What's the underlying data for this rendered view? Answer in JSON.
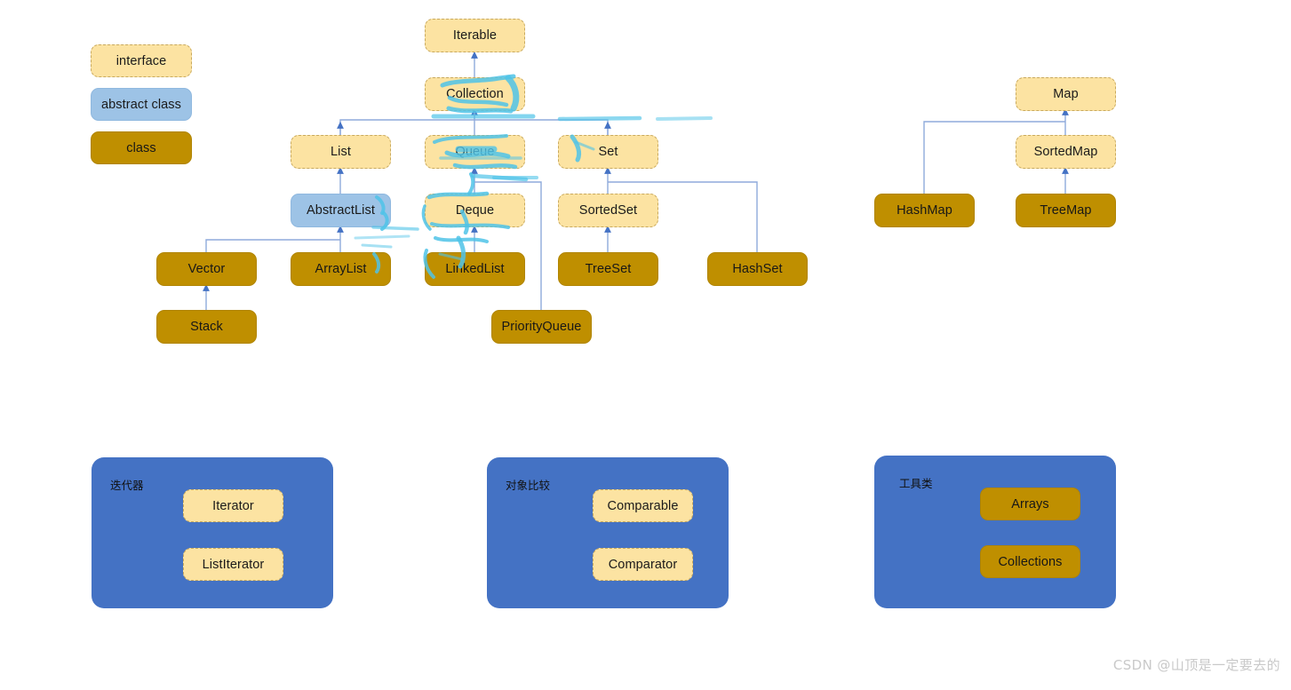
{
  "legend": {
    "items": [
      {
        "label": "interface",
        "kind": "interface",
        "color": "#FCE3A2"
      },
      {
        "label": "abstract class",
        "kind": "abstract",
        "color": "#9DC3E6"
      },
      {
        "label": "class",
        "kind": "class",
        "color": "#BF8F00"
      }
    ]
  },
  "collection_tree": {
    "nodes": [
      {
        "label": "Iterable",
        "kind": "interface"
      },
      {
        "label": "Collection",
        "kind": "interface"
      },
      {
        "label": "List",
        "kind": "interface"
      },
      {
        "label": "Queue",
        "kind": "interface"
      },
      {
        "label": "Set",
        "kind": "interface"
      },
      {
        "label": "AbstractList",
        "kind": "abstract"
      },
      {
        "label": "Deque",
        "kind": "interface"
      },
      {
        "label": "SortedSet",
        "kind": "interface"
      },
      {
        "label": "Vector",
        "kind": "class"
      },
      {
        "label": "ArrayList",
        "kind": "class"
      },
      {
        "label": "LinkedList",
        "kind": "class"
      },
      {
        "label": "TreeSet",
        "kind": "class"
      },
      {
        "label": "HashSet",
        "kind": "class"
      },
      {
        "label": "Stack",
        "kind": "class"
      },
      {
        "label": "PriorityQueue",
        "kind": "class"
      }
    ]
  },
  "map_tree": {
    "nodes": [
      {
        "label": "Map",
        "kind": "interface"
      },
      {
        "label": "SortedMap",
        "kind": "interface"
      },
      {
        "label": "HashMap",
        "kind": "class"
      },
      {
        "label": "TreeMap",
        "kind": "class"
      }
    ]
  },
  "panels": [
    {
      "title": "迭代器",
      "items": [
        {
          "label": "Iterator",
          "kind": "interface"
        },
        {
          "label": "ListIterator",
          "kind": "interface"
        }
      ]
    },
    {
      "title": "对象比较",
      "items": [
        {
          "label": "Comparable",
          "kind": "interface"
        },
        {
          "label": "Comparator",
          "kind": "interface"
        }
      ]
    },
    {
      "title": "工具类",
      "items": [
        {
          "label": "Arrays",
          "kind": "class"
        },
        {
          "label": "Collections",
          "kind": "class"
        }
      ]
    }
  ],
  "watermark": {
    "text": "CSDN @山顶是一定要去的"
  },
  "colors": {
    "interface_fill": "#FCE3A2",
    "interface_border": "#C8A95E",
    "abstract_fill": "#9DC3E6",
    "class_fill": "#BF8F00",
    "panel_fill": "#4472C4",
    "wire": "#8FAADC",
    "arrow": "#4472C4",
    "highlight": "#4FC3E8",
    "background": "#FFFFFF"
  }
}
